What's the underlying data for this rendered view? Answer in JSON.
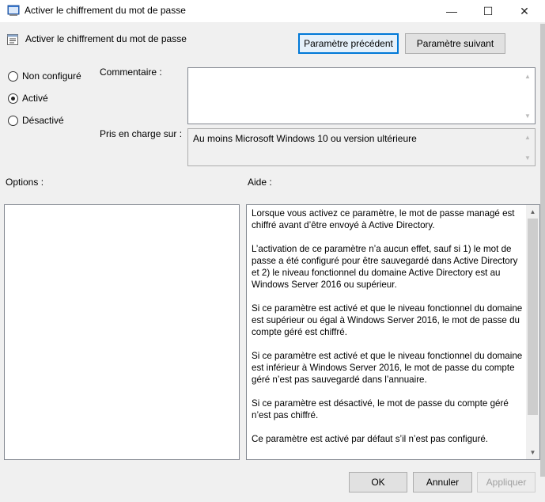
{
  "window": {
    "title": "Activer le chiffrement du mot de passe",
    "minimize_glyph": "—",
    "maximize_glyph": "☐",
    "close_glyph": "✕"
  },
  "header": {
    "policy_name": "Activer le chiffrement du mot de passe",
    "prev_button": "Paramètre précédent",
    "next_button": "Paramètre suivant"
  },
  "state": {
    "options": [
      {
        "label": "Non configuré",
        "checked": false
      },
      {
        "label": "Activé",
        "checked": true
      },
      {
        "label": "Désactivé",
        "checked": false
      }
    ]
  },
  "comment": {
    "label": "Commentaire :",
    "value": ""
  },
  "supported": {
    "label": "Pris en charge sur :",
    "value": "Au moins Microsoft Windows 10 ou version ultérieure"
  },
  "options_section": {
    "label": "Options :"
  },
  "help_section": {
    "label": "Aide :",
    "paragraphs": [
      "Lorsque vous activez ce paramètre, le mot de passe managé est chiffré avant d’être envoyé à Active Directory.",
      "L’activation de ce paramètre n’a aucun effet, sauf si 1) le mot de passe a été configuré pour être sauvegardé dans Active Directory et 2) le niveau fonctionnel du domaine Active Directory est au Windows Server 2016 ou supérieur.",
      "Si ce paramètre est activé et que le niveau fonctionnel du domaine est supérieur ou égal à Windows Server 2016, le mot de passe du compte géré est chiffré.",
      "Si ce paramètre est activé et que le niveau fonctionnel du domaine est inférieur à Windows Server 2016, le mot de passe du compte géré n’est pas sauvegardé dans l’annuaire.",
      "Si ce paramètre est désactivé, le mot de passe du compte géré n’est pas chiffré.",
      "Ce paramètre est activé par défaut s’il n’est pas configuré."
    ]
  },
  "footer": {
    "ok": "OK",
    "cancel": "Annuler",
    "apply": "Appliquer"
  }
}
